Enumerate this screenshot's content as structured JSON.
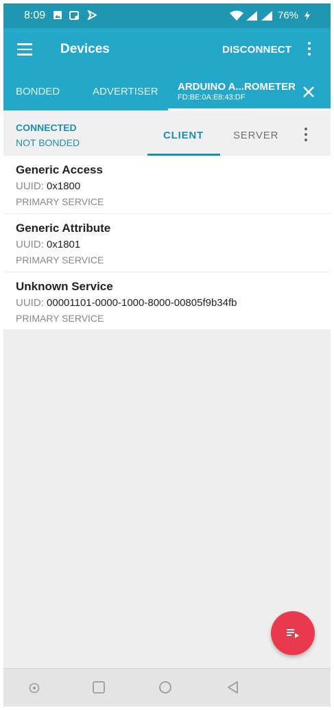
{
  "status_bar": {
    "time": "8:09",
    "battery": "76%"
  },
  "toolbar": {
    "title": "Devices",
    "disconnect_label": "DISCONNECT"
  },
  "tabs": {
    "bonded": "BONDED",
    "advertiser": "ADVERTISER",
    "device_name": "ARDUINO A...ROMETER",
    "device_mac": "FD:BE:0A:E8:43:DF"
  },
  "connection": {
    "state": "CONNECTED",
    "bond_state": "NOT BONDED"
  },
  "subtabs": {
    "client": "CLIENT",
    "server": "SERVER"
  },
  "services": [
    {
      "name": "Generic Access",
      "uuid_label": "UUID:",
      "uuid": "0x1800",
      "type": "PRIMARY SERVICE"
    },
    {
      "name": "Generic Attribute",
      "uuid_label": "UUID:",
      "uuid": "0x1801",
      "type": "PRIMARY SERVICE"
    },
    {
      "name": "Unknown Service",
      "uuid_label": "UUID:",
      "uuid": "00001101-0000-1000-8000-00805f9b34fb",
      "type": "PRIMARY SERVICE"
    }
  ],
  "colors": {
    "accent": "#24a8ca",
    "status": "#1f96b2",
    "fab": "#e8394f",
    "text_accent": "#1b8fad"
  },
  "icons": [
    "menu-icon",
    "overflow-menu-icon",
    "close-icon",
    "log-icon",
    "home-icon",
    "recents-icon",
    "back-icon"
  ]
}
